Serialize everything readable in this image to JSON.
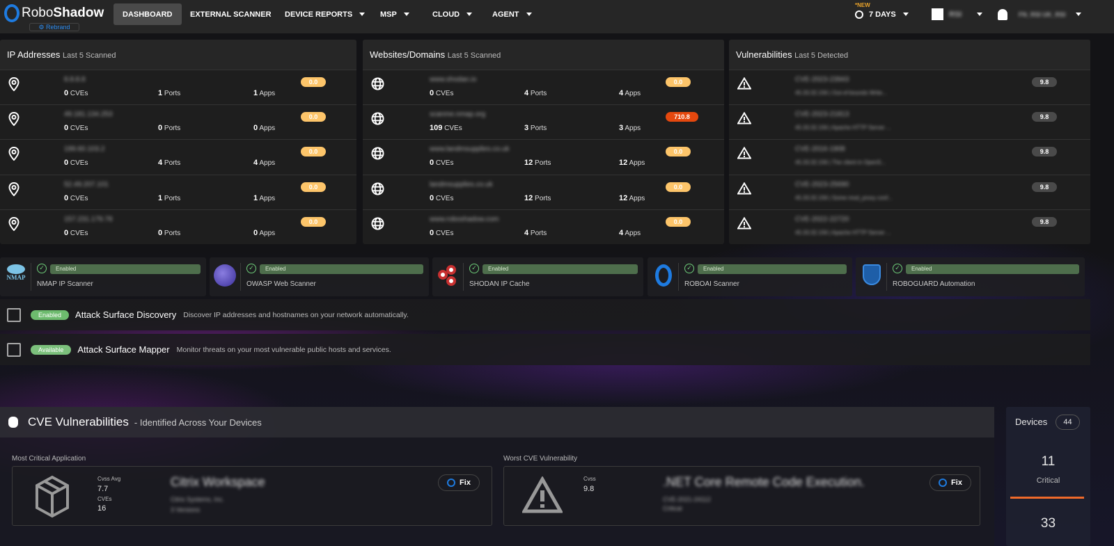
{
  "nav": {
    "brand": "RoboShadow",
    "brand_a": "Robo",
    "brand_b": "Shadow",
    "rebrand": "Rebrand",
    "items": [
      {
        "label": "DASHBOARD",
        "active": true
      },
      {
        "label": "EXTERNAL SCANNER"
      },
      {
        "label": "DEVICE REPORTS",
        "dropdown": true
      },
      {
        "label": "MSP",
        "dropdown": true
      },
      {
        "label": "CLOUD",
        "dropdown": true
      },
      {
        "label": "AGENT",
        "dropdown": true
      }
    ],
    "new_badge": "*NEW",
    "time_range": "7 DAYS",
    "org": "RSI",
    "user": "FN_RSI UK_RSI"
  },
  "colors": {
    "accent": "#1e7be0",
    "score_low": "#fdc56a",
    "score_high": "#e5480e",
    "enabled": "#6dbb6e"
  },
  "ip_panel": {
    "title": "IP Addresses",
    "subtitle": "Last 5 Scanned",
    "icon": "map-pin-icon",
    "rows": [
      {
        "name": "8.8.8.8",
        "cves": "0",
        "ports": "1",
        "apps": "1",
        "score": "0.0"
      },
      {
        "name": "49.181.134.253",
        "cves": "0",
        "ports": "0",
        "apps": "0",
        "score": "0.0"
      },
      {
        "name": "199.60.103.2",
        "cves": "0",
        "ports": "4",
        "apps": "4",
        "score": "0.0"
      },
      {
        "name": "52.49.207.101",
        "cves": "0",
        "ports": "1",
        "apps": "1",
        "score": "0.0"
      },
      {
        "name": "157.231.179.78",
        "cves": "0",
        "ports": "0",
        "apps": "0",
        "score": "0.0"
      }
    ]
  },
  "web_panel": {
    "title": "Websites/Domains",
    "subtitle": "Last 5 Scanned",
    "icon": "globe-icon",
    "rows": [
      {
        "name": "www.shodan.io",
        "cves": "0",
        "ports": "4",
        "apps": "4",
        "score": "0.0"
      },
      {
        "name": "scanme.nmap.org",
        "cves": "109",
        "ports": "3",
        "apps": "3",
        "score": "710.8",
        "high": true
      },
      {
        "name": "www.landmsupplies.co.uk",
        "cves": "0",
        "ports": "12",
        "apps": "12",
        "score": "0.0"
      },
      {
        "name": "landmsupplies.co.uk",
        "cves": "0",
        "ports": "12",
        "apps": "12",
        "score": "0.0"
      },
      {
        "name": "www.roboshadow.com",
        "cves": "0",
        "ports": "4",
        "apps": "4",
        "score": "0.0"
      }
    ]
  },
  "labels": {
    "cves": "CVEs",
    "ports": "Ports",
    "apps": "Apps"
  },
  "vuln_panel": {
    "title": "Vulnerabilities",
    "subtitle": "Last 5 Detected",
    "icon": "warning-icon",
    "rows": [
      {
        "id": "CVE-2023-23943",
        "detail": "45.33.32.156 | Out-of-bounds Write...",
        "score": "9.8"
      },
      {
        "id": "CVE-2023-21813",
        "detail": "45.33.32.156 | Apache HTTP Server ...",
        "score": "9.8"
      },
      {
        "id": "CVE-2016-1908",
        "detail": "45.33.32.156 | The client in OpenS...",
        "score": "9.8"
      },
      {
        "id": "CVE-2023-25690",
        "detail": "45.33.32.156 | Some mod_proxy conf...",
        "score": "9.8"
      },
      {
        "id": "CVE-2022-22720",
        "detail": "45.33.32.156 | Apache HTTP Server ...",
        "score": "9.8"
      }
    ]
  },
  "scanners": [
    {
      "name": "NMAP IP Scanner",
      "status": "Enabled",
      "logo": "nmap-logo",
      "logo_text": "NMAP"
    },
    {
      "name": "OWASP Web Scanner",
      "status": "Enabled",
      "logo": "owasp-logo"
    },
    {
      "name": "SHODAN IP Cache",
      "status": "Enabled",
      "logo": "shodan-logo"
    },
    {
      "name": "ROBOAI Scanner",
      "status": "Enabled",
      "logo": "roboai-logo"
    },
    {
      "name": "ROBOGUARD Automation",
      "status": "Enabled",
      "logo": "roboguard-logo"
    }
  ],
  "features": [
    {
      "title": "Attack Surface Discovery",
      "status": "Enabled",
      "desc": "Discover IP addresses and hostnames on your network automatically."
    },
    {
      "title": "Attack Surface Mapper",
      "status": "Available",
      "desc": "Monitor threats on your most vulnerable public hosts and services."
    }
  ],
  "cve": {
    "title": "CVE Vulnerabilities",
    "subtitle": "- Identified Across Your Devices",
    "app": {
      "label": "Most Critical Application",
      "cvss_label": "Cvss Avg",
      "cvss": "7.7",
      "cves_label": "CVEs",
      "cves": "16",
      "name": "Citrix Workspace",
      "vendor": "Citrix Systems, Inc.",
      "versions": "3 Versions",
      "fix": "Fix"
    },
    "worst": {
      "label": "Worst CVE Vulnerability",
      "cvss_label": "Cvss",
      "cvss": "9.8",
      "name": ".NET Core Remote Code Execution.",
      "id": "CVE-2021-24112",
      "severity": "Critical",
      "fix": "Fix"
    }
  },
  "devices": {
    "title": "Devices",
    "count": "44",
    "critical": "11",
    "critical_label": "Critical",
    "next": "33"
  }
}
